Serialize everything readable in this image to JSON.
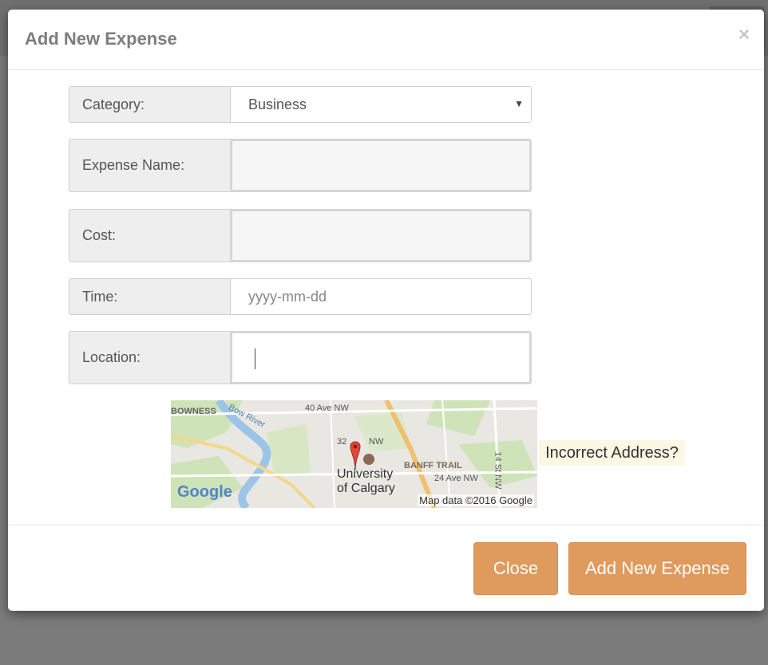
{
  "modal": {
    "title": "Add New Expense",
    "close_symbol": "×"
  },
  "form": {
    "category": {
      "label": "Category:",
      "value": "Business"
    },
    "expense_name": {
      "label": "Expense Name:",
      "value": ""
    },
    "cost": {
      "label": "Cost:",
      "value": ""
    },
    "time": {
      "label": "Time:",
      "placeholder": "yyyy-mm-dd"
    },
    "location": {
      "label": "Location:",
      "value": ""
    }
  },
  "map": {
    "labels": {
      "bowness": "BOWNESS",
      "bow_river": "Bow River",
      "ave40": "40 Ave NW",
      "street32": "32",
      "nw": "NW",
      "banff_trail": "BANFF TRAIL",
      "ave24": "24 Ave NW",
      "st14": "14 St NW",
      "university1": "University",
      "university2": "of Calgary",
      "credit": "Map data ©2016 Google",
      "google": "Google"
    },
    "incorrect_link": "Incorrect Address?"
  },
  "footer": {
    "close_label": "Close",
    "add_label": "Add New Expense"
  },
  "colors": {
    "accent": "#df9a5d",
    "overlay": "#7b7b7b"
  }
}
